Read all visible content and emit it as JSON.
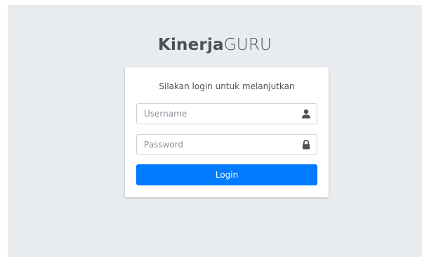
{
  "logo": {
    "bold": "Kinerja",
    "light": "GURU"
  },
  "card": {
    "subtitle": "Silakan login untuk melanjutkan",
    "username": {
      "placeholder": "Username",
      "value": "",
      "icon": "user-icon"
    },
    "password": {
      "placeholder": "Password",
      "value": "",
      "icon": "lock-icon"
    },
    "login_label": "Login"
  },
  "colors": {
    "page_bg": "#e9ecef",
    "card_bg": "#ffffff",
    "primary": "#007bff",
    "text": "#495057",
    "icon": "#495057",
    "input_border": "#ced4da"
  }
}
